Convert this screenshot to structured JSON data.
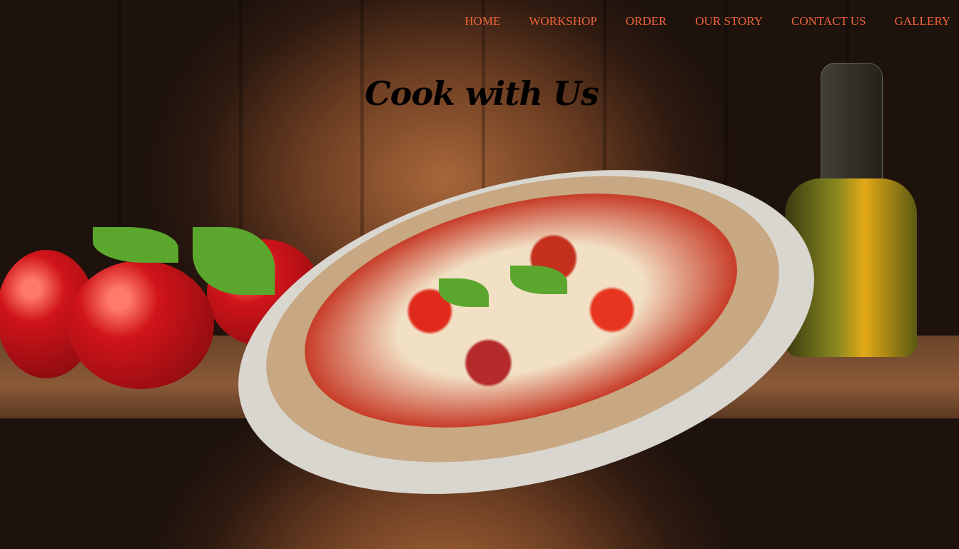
{
  "nav": {
    "items": [
      "HOME",
      "WORKSHOP",
      "ORDER",
      "OUR STORY",
      "CONTACT US",
      "GALLERY"
    ]
  },
  "hero": {
    "title": "Cook with Us"
  },
  "colors": {
    "nav_link": "#f0643a",
    "title": "#000000"
  }
}
